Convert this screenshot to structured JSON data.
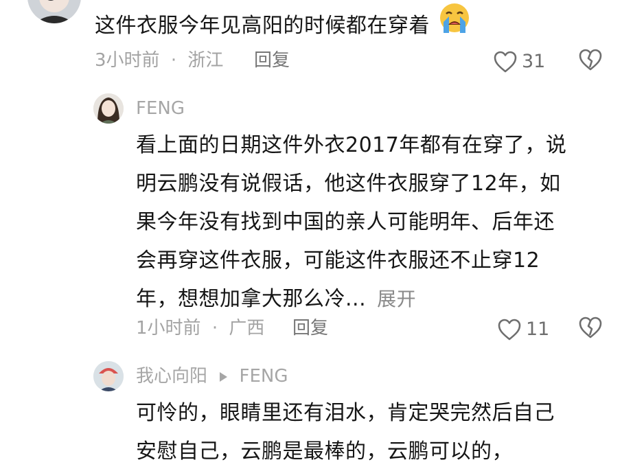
{
  "comment1": {
    "text": "这件衣服今年见高阳的时候都在穿着",
    "emoji": "loudly-crying-face-icon",
    "time": "3小时前",
    "separator": "·",
    "location": "浙江",
    "reply_label": "回复",
    "like_count": "31"
  },
  "reply1": {
    "username": "FENG",
    "lines": [
      "看上面的日期这件外衣2017年都有在穿了，说",
      "明云鹏没有说假话，他这件衣服穿了12年，如",
      "果今年没有找到中国的亲人可能明年、后年还",
      "会再穿这件衣服，可能这件衣服还不止穿12",
      "年，想想加拿大那么冷..."
    ],
    "expand_label": "展开",
    "time": "1小时前",
    "separator": "·",
    "location": "广西",
    "reply_label": "回复",
    "like_count": "11"
  },
  "reply2": {
    "username": "我心向阳",
    "reply_to": "FENG",
    "lines": [
      "可怜的，眼睛里还有泪水，肯定哭完然后自己",
      "安慰自己，云鹏是最棒的，云鹏可以的，"
    ]
  },
  "colors": {
    "text": "#161616",
    "meta": "#a3a3a3",
    "icon": "#6e6e6e"
  }
}
